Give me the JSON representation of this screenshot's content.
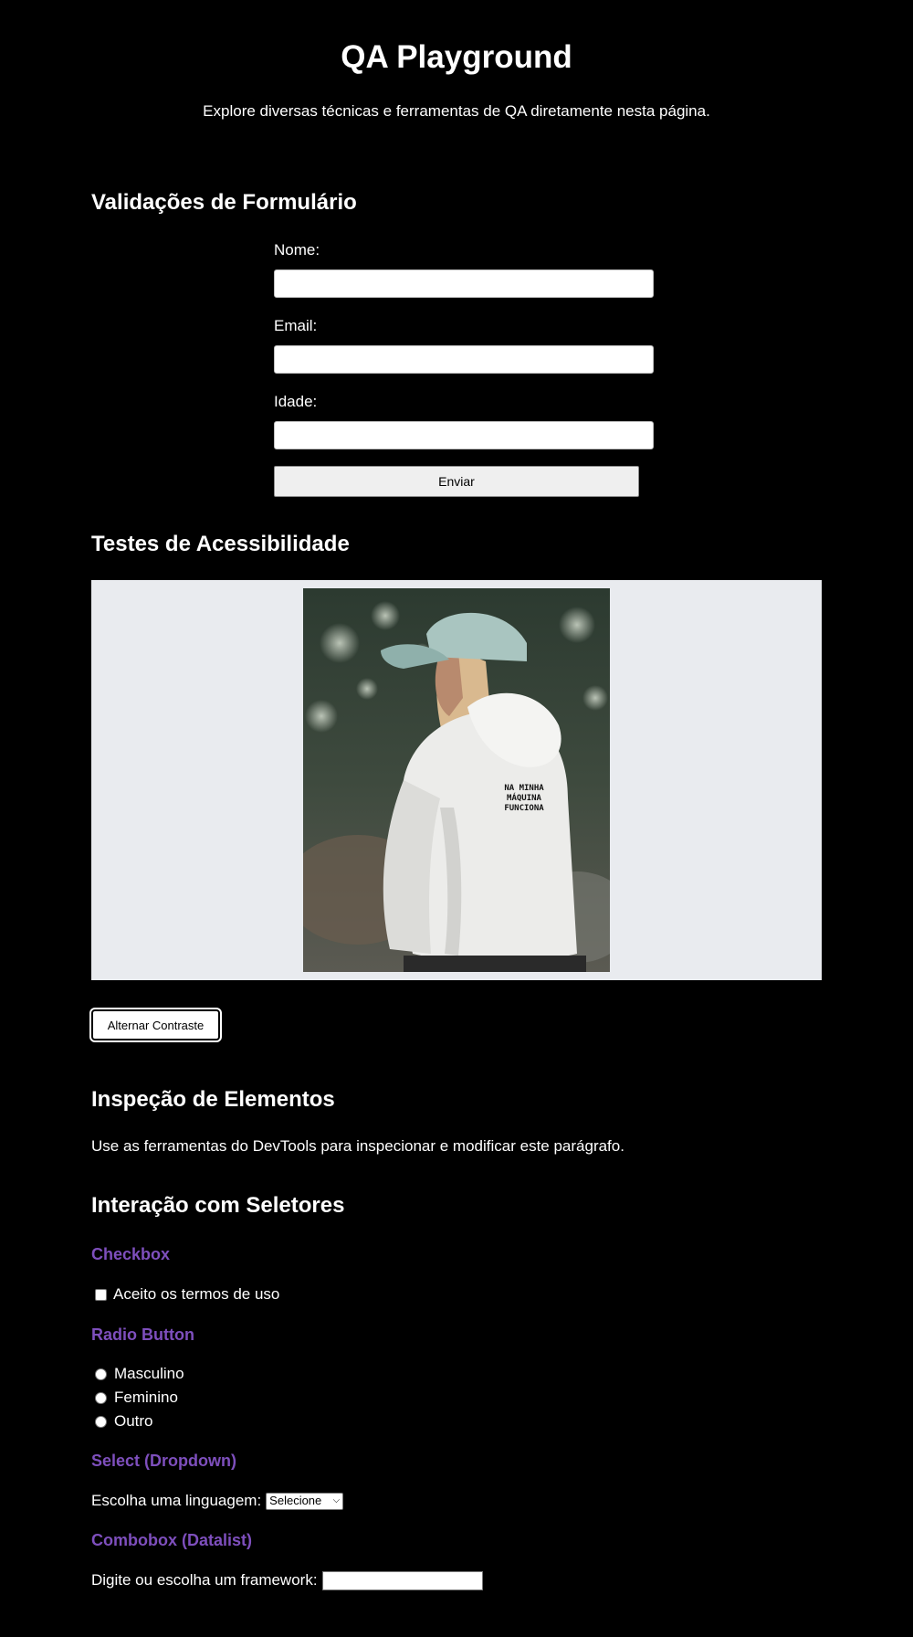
{
  "header": {
    "title": "QA Playground",
    "subtitle": "Explore diversas técnicas e ferramentas de QA diretamente nesta página."
  },
  "form_section": {
    "heading": "Validações de Formulário",
    "fields": [
      {
        "label": "Nome:",
        "value": "",
        "placeholder": ""
      },
      {
        "label": "Email:",
        "value": "",
        "placeholder": ""
      },
      {
        "label": "Idade:",
        "value": "",
        "placeholder": ""
      }
    ],
    "submit_label": "Enviar"
  },
  "accessibility_section": {
    "heading": "Testes de Acessibilidade",
    "image_text": [
      "NA MINHA",
      "MÁQUINA",
      "FUNCIONA"
    ],
    "contrast_button_label": "Alternar Contraste",
    "panel_color": "#e9ebef"
  },
  "inspection_section": {
    "heading": "Inspeção de Elementos",
    "paragraph": "Use as ferramentas do DevTools para inspecionar e modificar este parágrafo."
  },
  "selectors_section": {
    "heading": "Interação com Seletores",
    "subheading_color": "#7e4fbd",
    "checkbox": {
      "heading": "Checkbox",
      "label": "Aceito os termos de uso",
      "checked": false
    },
    "radio": {
      "heading": "Radio Button",
      "options": [
        "Masculino",
        "Feminino",
        "Outro"
      ]
    },
    "select": {
      "heading": "Select (Dropdown)",
      "label": "Escolha uma linguagem:",
      "selected": "Selecione"
    },
    "combobox": {
      "heading": "Combobox (Datalist)",
      "label": "Digite ou escolha um framework:",
      "value": ""
    }
  }
}
